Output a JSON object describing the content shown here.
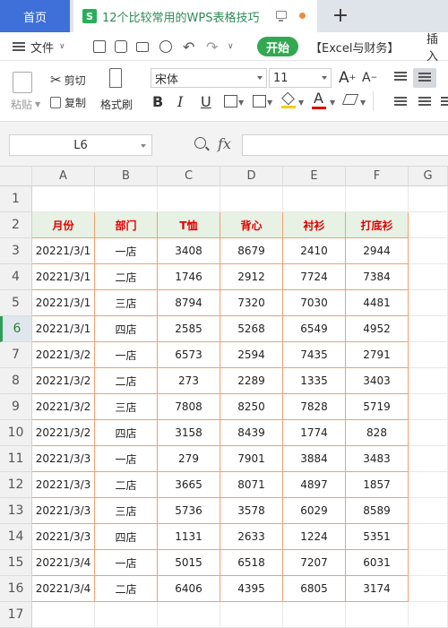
{
  "tabs": {
    "home": "首页",
    "doc_badge": "S",
    "doc_title": "12个比较常用的WPS表格技巧",
    "new_tab": "+"
  },
  "menu": {
    "file": "文件",
    "start": "开始",
    "excel_finance": "【Excel与财务】",
    "insert": "插入"
  },
  "ribbon": {
    "paste": "粘贴",
    "cut": "剪切",
    "copy": "复制",
    "format_painter": "格式刷",
    "font_name": "宋体",
    "font_size": "11",
    "grow_font": "A",
    "shrink_font": "A",
    "bold": "B",
    "italic": "I",
    "underline": "U",
    "font_color_glyph": "A"
  },
  "formula_bar": {
    "name_box": "L6",
    "fx": "fx",
    "formula": ""
  },
  "sheet": {
    "columns": [
      "A",
      "B",
      "C",
      "D",
      "E",
      "F",
      "G"
    ],
    "row_numbers": [
      "1",
      "2",
      "3",
      "4",
      "5",
      "6",
      "7",
      "8",
      "9",
      "10",
      "11",
      "12",
      "13",
      "14",
      "15",
      "16",
      "17"
    ],
    "active_row": "6",
    "header": [
      "月份",
      "部门",
      "T恤",
      "背心",
      "衬衫",
      "打底衫"
    ],
    "rows": [
      [
        "20221/3/1",
        "一店",
        "3408",
        "8679",
        "2410",
        "2944"
      ],
      [
        "20221/3/1",
        "二店",
        "1746",
        "2912",
        "7724",
        "7384"
      ],
      [
        "20221/3/1",
        "三店",
        "8794",
        "7320",
        "7030",
        "4481"
      ],
      [
        "20221/3/1",
        "四店",
        "2585",
        "5268",
        "6549",
        "4952"
      ],
      [
        "20221/3/2",
        "一店",
        "6573",
        "2594",
        "7435",
        "2791"
      ],
      [
        "20221/3/2",
        "二店",
        "273",
        "2289",
        "1335",
        "3403"
      ],
      [
        "20221/3/2",
        "三店",
        "7808",
        "8250",
        "7828",
        "5719"
      ],
      [
        "20221/3/2",
        "四店",
        "3158",
        "8439",
        "1774",
        "828"
      ],
      [
        "20221/3/3",
        "一店",
        "279",
        "7901",
        "3884",
        "3483"
      ],
      [
        "20221/3/3",
        "二店",
        "3665",
        "8071",
        "4897",
        "1857"
      ],
      [
        "20221/3/3",
        "三店",
        "5736",
        "3578",
        "6029",
        "8589"
      ],
      [
        "20221/3/3",
        "四店",
        "1131",
        "2633",
        "1224",
        "5351"
      ],
      [
        "20221/3/4",
        "一店",
        "5015",
        "6518",
        "7207",
        "6031"
      ],
      [
        "20221/3/4",
        "二店",
        "6406",
        "4395",
        "6805",
        "3174"
      ]
    ]
  },
  "colors": {
    "home_tab": "#3f6fd8",
    "start_button": "#33a852",
    "header_fill": "#e7f1e4",
    "header_text": "#e00000",
    "table_border": "#f0a070"
  }
}
